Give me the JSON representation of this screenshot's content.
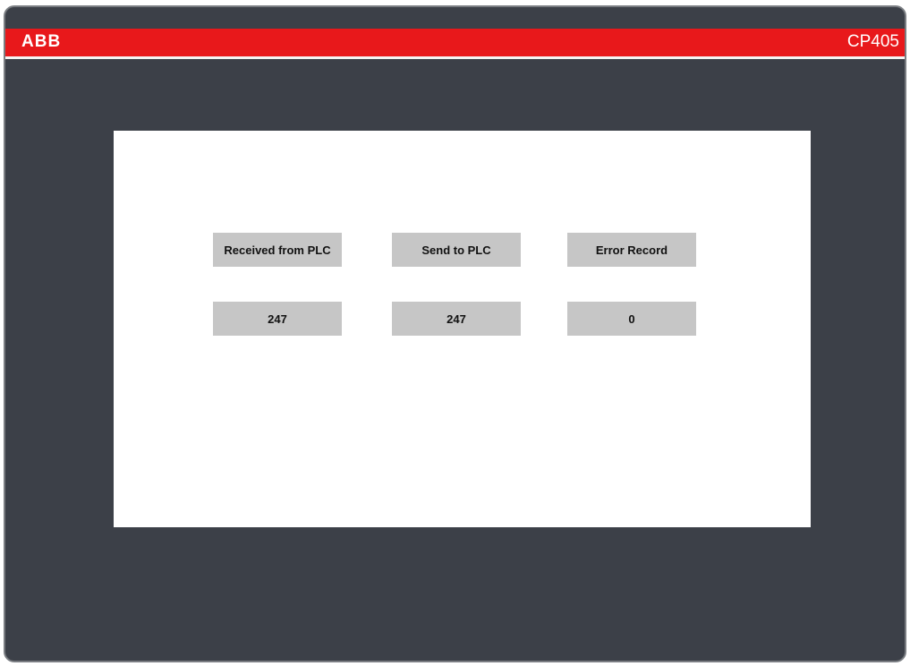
{
  "header": {
    "brand": "ABB",
    "model": "CP405"
  },
  "panel": {
    "buttons": [
      {
        "label": "Received from PLC"
      },
      {
        "label": "Send to PLC"
      },
      {
        "label": "Error Record"
      }
    ],
    "values": [
      {
        "value": "247"
      },
      {
        "value": "247"
      },
      {
        "value": "0"
      }
    ]
  },
  "colors": {
    "bezel": "#3c4048",
    "brand_red": "#e8181b",
    "cell_gray": "#c6c6c6",
    "screen": "#ffffff"
  }
}
